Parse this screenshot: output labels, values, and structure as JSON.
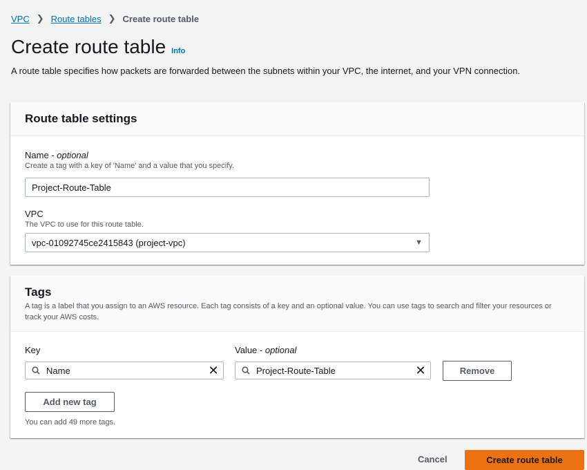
{
  "breadcrumb": {
    "item1": "VPC",
    "item2": "Route tables",
    "current": "Create route table"
  },
  "page": {
    "title": "Create route table",
    "info": "Info",
    "description": "A route table specifies how packets are forwarded between the subnets within your VPC, the internet, and your VPN connection."
  },
  "settings": {
    "header": "Route table settings",
    "name_label": "Name - ",
    "name_optional": "optional",
    "name_desc": "Create a tag with a key of 'Name' and a value that you specify.",
    "name_value": "Project-Route-Table",
    "vpc_label": "VPC",
    "vpc_desc": "The VPC to use for this route table.",
    "vpc_value": "vpc-01092745ce2415843 (project-vpc)"
  },
  "tags": {
    "header": "Tags",
    "description": "A tag is a label that you assign to an AWS resource. Each tag consists of a key and an optional value. You can use tags to search and filter your resources or track your AWS costs.",
    "key_label": "Key",
    "value_label": "Value - ",
    "value_optional": "optional",
    "key_value": "Name",
    "value_value": "Project-Route-Table",
    "remove_label": "Remove",
    "add_label": "Add new tag",
    "remaining": "You can add 49 more tags."
  },
  "footer": {
    "cancel": "Cancel",
    "create": "Create route table"
  },
  "colors": {
    "accent": "#ec7211",
    "link": "#0073bb"
  }
}
